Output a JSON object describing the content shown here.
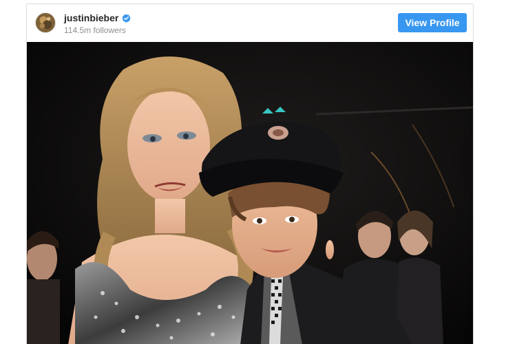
{
  "post": {
    "username": "justinbieber",
    "followers": "114.5m followers",
    "view_profile_label": "View Profile",
    "verified": true
  },
  "colors": {
    "button": "#3897f0",
    "verified_badge": "#3897f0",
    "username": "#262626",
    "secondary_text": "#8e8e8e"
  },
  "icons": {
    "verified": "verified-badge-icon",
    "avatar": "profile-avatar"
  }
}
